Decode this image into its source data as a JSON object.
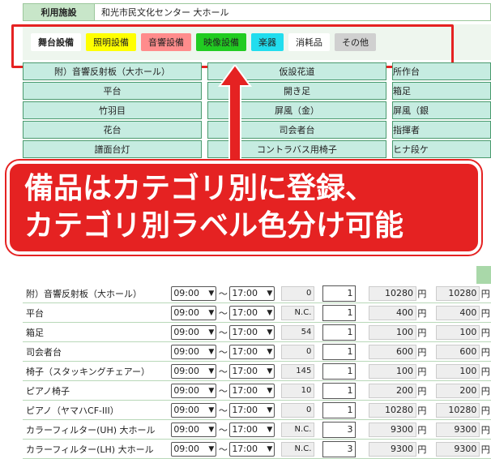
{
  "facility": {
    "label": "利用施設",
    "value": "和光市民文化センター 大ホール"
  },
  "tabs": [
    {
      "label": "舞台設備",
      "bg": "#ffffff",
      "active": true
    },
    {
      "label": "照明設備",
      "bg": "#ffff00",
      "active": false
    },
    {
      "label": "音響設備",
      "bg": "#ff8c8c",
      "active": false
    },
    {
      "label": "映像設備",
      "bg": "#22cc22",
      "active": false
    },
    {
      "label": "楽器",
      "bg": "#22ddee",
      "active": false
    },
    {
      "label": "消耗品",
      "bg": "#ffffff",
      "active": false
    },
    {
      "label": "その他",
      "bg": "#d0d0d0",
      "active": false
    }
  ],
  "equipment_grid": [
    [
      "附）音響反射板（大ホール）",
      "仮設花道",
      "所作台"
    ],
    [
      "平台",
      "開き足",
      "箱足"
    ],
    [
      "竹羽目",
      "屏風（金）",
      "屏風（銀"
    ],
    [
      "花台",
      "司会者台",
      "指揮者"
    ],
    [
      "譜面台灯",
      "コントラバス用椅子",
      "ヒナ段ケ"
    ]
  ],
  "callout": {
    "line1": "備品はカテゴリ別に登録、",
    "line2": "カテゴリ別ラベル色分け可能"
  },
  "rows": [
    {
      "name": "附）音響反射板（大ホール）",
      "start": "09:00",
      "end": "17:00",
      "stock": "0",
      "qty": "1",
      "price": "10280",
      "subtotal": "10280"
    },
    {
      "name": "平台",
      "start": "09:00",
      "end": "17:00",
      "stock": "N.C.",
      "qty": "1",
      "price": "400",
      "subtotal": "400"
    },
    {
      "name": "箱足",
      "start": "09:00",
      "end": "17:00",
      "stock": "54",
      "qty": "1",
      "price": "100",
      "subtotal": "100"
    },
    {
      "name": "司会者台",
      "start": "09:00",
      "end": "17:00",
      "stock": "0",
      "qty": "1",
      "price": "600",
      "subtotal": "600"
    },
    {
      "name": "椅子（スタッキングチェアー）",
      "start": "09:00",
      "end": "17:00",
      "stock": "145",
      "qty": "1",
      "price": "100",
      "subtotal": "100"
    },
    {
      "name": "ピアノ椅子",
      "start": "09:00",
      "end": "17:00",
      "stock": "10",
      "qty": "1",
      "price": "200",
      "subtotal": "200"
    },
    {
      "name": "ピアノ（ヤマハCF-III）",
      "start": "09:00",
      "end": "17:00",
      "stock": "0",
      "qty": "1",
      "price": "10280",
      "subtotal": "10280"
    },
    {
      "name": "カラーフィルター(UH) 大ホール",
      "start": "09:00",
      "end": "17:00",
      "stock": "N.C.",
      "qty": "3",
      "price": "9300",
      "subtotal": "9300"
    },
    {
      "name": "カラーフィルター(LH) 大ホール",
      "start": "09:00",
      "end": "17:00",
      "stock": "N.C.",
      "qty": "3",
      "price": "9300",
      "subtotal": "9300"
    }
  ],
  "labels": {
    "tilde": "～",
    "yen": "円"
  },
  "colors": {
    "accent_red": "#e52222",
    "grid_cell": "#c6ece1"
  }
}
